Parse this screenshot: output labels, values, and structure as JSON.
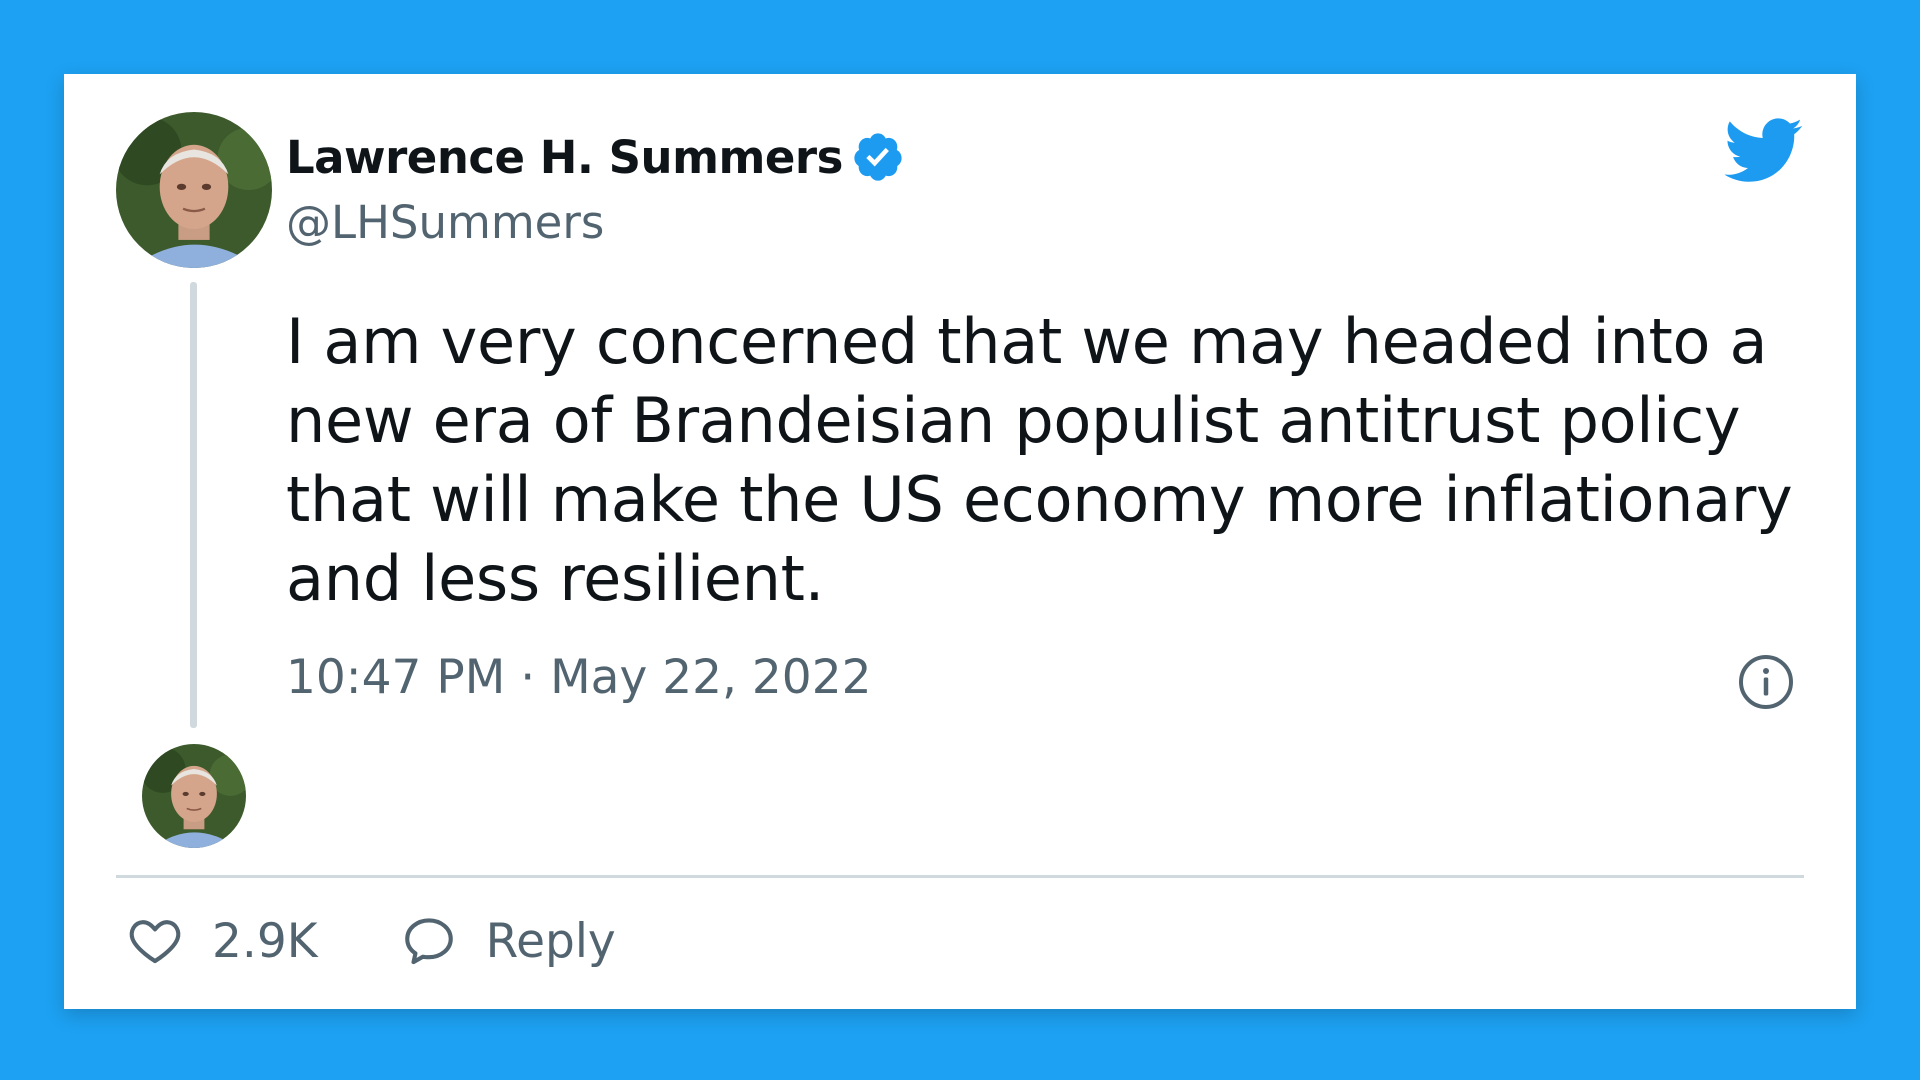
{
  "author": {
    "display_name": "Lawrence H. Summers",
    "handle": "@LHSummers",
    "verified": true
  },
  "tweet": {
    "text": "I am very concerned that we may headed into a new era of Brandeisian populist antitrust policy that will make the US economy more inflationary and less resilient.",
    "timestamp": "10:47 PM · May 22, 2022"
  },
  "actions": {
    "like_count": "2.9K",
    "reply_label": "Reply"
  },
  "icons": {
    "brand": "twitter-bird-icon",
    "verified": "verified-badge-icon",
    "info": "info-icon",
    "like": "heart-icon",
    "reply": "speech-bubble-icon"
  },
  "colors": {
    "background": "#1DA1F2",
    "brand": "#1D9BF0",
    "text_primary": "#0F1419",
    "text_secondary": "#536471",
    "divider": "#CFD9DE"
  }
}
